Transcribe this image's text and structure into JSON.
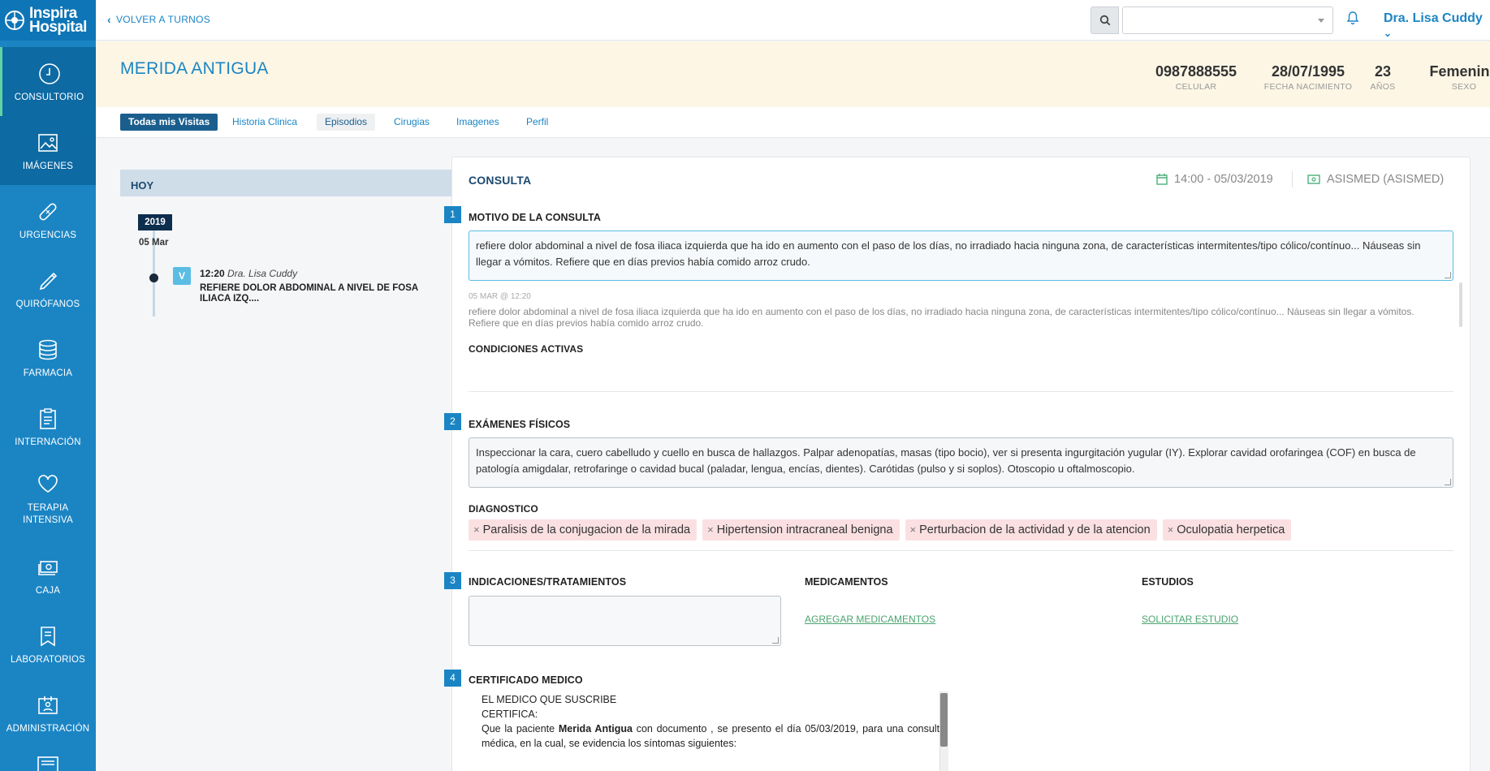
{
  "app": {
    "logo_line1": "Inspira",
    "logo_line2": "Hospital"
  },
  "sidebar": {
    "items": [
      {
        "label": "CONSULTORIO",
        "icon": "clock-icon"
      },
      {
        "label": "IMÁGENES",
        "icon": "image-icon"
      },
      {
        "label": "URGENCIAS",
        "icon": "bandage-icon"
      },
      {
        "label": "QUIRÓFANOS",
        "icon": "scalpel-icon"
      },
      {
        "label": "FARMACIA",
        "icon": "database-icon"
      },
      {
        "label": "INTERNACIÓN",
        "icon": "clipboard-icon"
      },
      {
        "label": "TERAPIA INTENSIVA",
        "icon": "heart-icon"
      },
      {
        "label": "CAJA",
        "icon": "money-icon"
      },
      {
        "label": "LABORATORIOS",
        "icon": "bookmark-icon"
      },
      {
        "label": "ADMINISTRACIÓN",
        "icon": "id-card-icon"
      }
    ]
  },
  "header": {
    "back_label": "VOLVER A TURNOS",
    "search_placeholder": "",
    "user_name": "Dra. Lisa Cuddy"
  },
  "patient": {
    "name": "MERIDA ANTIGUA",
    "phone": "0987888555",
    "phone_label": "CELULAR",
    "birth": "28/07/1995",
    "birth_label": "FECHA NACIMIENTO",
    "age": "23",
    "age_label": "AÑOS",
    "sex": "Femenino",
    "sex_label": "SEXO"
  },
  "tabs": [
    "Todas mis Visitas",
    "Historia Clinica",
    "Episodios",
    "Cirugias",
    "Imagenes",
    "Perfil"
  ],
  "timeline": {
    "header": "HOY",
    "year": "2019",
    "date": "05 Mar",
    "visit_badge": "V",
    "visit_time": "12:20",
    "visit_doctor": "Dra. Lisa Cuddy",
    "visit_desc": "REFIERE DOLOR ABDOMINAL A NIVEL DE FOSA ILIACA IZQ...."
  },
  "consulta": {
    "title": "CONSULTA",
    "datetime": "14:00 - 05/03/2019",
    "insurance": "ASISMED (ASISMED)",
    "sections": {
      "s1_num": "1",
      "s1_title": "MOTIVO DE LA CONSULTA",
      "s1_text": "refiere dolor abdominal a nivel de fosa iliaca izquierda que ha ido en aumento con el paso de los días, no irradiado hacia ninguna zona, de características intermitentes/tipo cólico/contínuo... Náuseas sin llegar a vómitos. Refiere que en días previos había comido arroz crudo.",
      "hist_date": "05 MAR @ 12:20",
      "hist_text": "refiere dolor abdominal a nivel de fosa iliaca izquierda que ha ido en aumento con el paso de los días, no irradiado hacia ninguna zona, de características intermitentes/tipo cólico/contínuo... Náuseas sin llegar a vómitos. Refiere que en días previos había comido arroz crudo.",
      "conditions_title": "CONDICIONES ACTIVAS",
      "s2_num": "2",
      "s2_title": "EXÁMENES FÍSICOS",
      "s2_text": "Inspeccionar la cara, cuero cabelludo y cuello en busca de hallazgos. Palpar adenopatías, masas (tipo bocio), ver si presenta ingurgitación yugular (IY). Explorar cavidad orofaringea (COF) en busca de patología amigdalar, retrofaringe o cavidad bucal (paladar, lengua, encías, dientes). Carótidas (pulso y si soplos). Otoscopio u oftalmoscopio.",
      "diag_title": "DIAGNOSTICO",
      "diagnoses": [
        "Paralisis de la conjugacion de la mirada",
        "Hipertension intracraneal benigna",
        "Perturbacion de la actividad y de la atencion",
        "Oculopatia herpetica"
      ],
      "s3_num": "3",
      "s3_title": "INDICACIONES/TRATAMIENTOS",
      "med_title": "MEDICAMENTOS",
      "med_link": "AGREGAR MEDICAMENTOS",
      "est_title": "ESTUDIOS",
      "est_link": "SOLICITAR ESTUDIO",
      "s4_num": "4",
      "s4_title": "CERTIFICADO MEDICO",
      "cert_line1": "EL MEDICO QUE SUSCRIBE",
      "cert_line2": "CERTIFICA:",
      "cert_line3a": "Que la paciente",
      "cert_patient": "Merida Antigua",
      "cert_line3b": "con documento , se presento el día 05/03/2019, para una consulta médica, en la cual, se evidencia los síntomas siguientes:"
    }
  },
  "colors": {
    "sidebar": "#1b85c4",
    "accent": "#1b85c4",
    "patient_bg": "#fdf6e5",
    "chip_bg": "#fbe0e2",
    "link_green": "#4aa36e"
  }
}
